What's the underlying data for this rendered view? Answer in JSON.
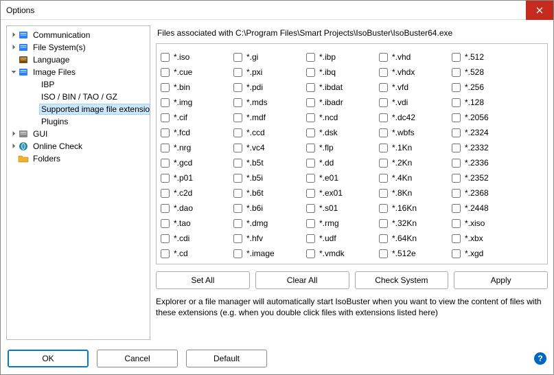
{
  "window": {
    "title": "Options"
  },
  "tree": [
    {
      "label": "Communication",
      "iconColor": "#2a7fff",
      "caret": ">",
      "indent": 1,
      "selected": false,
      "hasIcon": true
    },
    {
      "label": "File System(s)",
      "iconColor": "#2a7fff",
      "caret": ">",
      "indent": 1,
      "selected": false,
      "hasIcon": true
    },
    {
      "label": "Language",
      "iconColor": "#7f4f00",
      "caret": "",
      "indent": 1,
      "selected": false,
      "hasIcon": true
    },
    {
      "label": "Image Files",
      "iconColor": "#2a7fff",
      "caret": "v",
      "indent": 1,
      "selected": false,
      "hasIcon": true
    },
    {
      "label": "IBP",
      "iconColor": "",
      "caret": "",
      "indent": 2,
      "selected": false,
      "hasIcon": false
    },
    {
      "label": "ISO / BIN / TAO / GZ",
      "iconColor": "",
      "caret": "",
      "indent": 2,
      "selected": false,
      "hasIcon": false
    },
    {
      "label": "Supported image file extension",
      "iconColor": "",
      "caret": "",
      "indent": 2,
      "selected": true,
      "hasIcon": false
    },
    {
      "label": "Plugins",
      "iconColor": "",
      "caret": "",
      "indent": 2,
      "selected": false,
      "hasIcon": false
    },
    {
      "label": "GUI",
      "iconColor": "#888",
      "caret": ">",
      "indent": 1,
      "selected": false,
      "hasIcon": true
    },
    {
      "label": "Online Check",
      "iconColor": "#1a8f1a",
      "caret": ">",
      "indent": 1,
      "selected": false,
      "hasIcon": true
    },
    {
      "label": "Folders",
      "iconColor": "#f0b030",
      "caret": "",
      "indent": 1,
      "selected": false,
      "hasIcon": true
    }
  ],
  "heading": "Files associated with C:\\Program Files\\Smart Projects\\IsoBuster\\IsoBuster64.exe",
  "extensions": [
    [
      "*.iso",
      "*.cue",
      "*.bin",
      "*.img",
      "*.cif",
      "*.fcd",
      "*.nrg",
      "*.gcd",
      "*.p01",
      "*.c2d",
      "*.dao",
      "*.tao",
      "*.cdi",
      "*.cd"
    ],
    [
      "*.gi",
      "*.pxi",
      "*.pdi",
      "*.mds",
      "*.mdf",
      "*.ccd",
      "*.vc4",
      "*.b5t",
      "*.b5i",
      "*.b6t",
      "*.b6i",
      "*.dmg",
      "*.hfv",
      "*.image"
    ],
    [
      "*.ibp",
      "*.ibq",
      "*.ibdat",
      "*.ibadr",
      "*.ncd",
      "*.dsk",
      "*.flp",
      "*.dd",
      "*.e01",
      "*.ex01",
      "*.s01",
      "*.rmg",
      "*.udf",
      "*.vmdk"
    ],
    [
      "*.vhd",
      "*.vhdx",
      "*.vfd",
      "*.vdi",
      "*.dc42",
      "*.wbfs",
      "*.1Kn",
      "*.2Kn",
      "*.4Kn",
      "*.8Kn",
      "*.16Kn",
      "*.32Kn",
      "*.64Kn",
      "*.512e"
    ],
    [
      "*.512",
      "*.528",
      "*.256",
      "*.128",
      "*.2056",
      "*.2324",
      "*.2332",
      "*.2336",
      "*.2352",
      "*.2368",
      "*.2448",
      "*.xiso",
      "*.xbx",
      "*.xgd"
    ]
  ],
  "buttons": {
    "set_all": "Set All",
    "clear_all": "Clear All",
    "check_system": "Check System",
    "apply": "Apply"
  },
  "explain": "Explorer or a file manager will automatically start IsoBuster when you want to view the content of files with these extensions (e.g. when you double click files with extensions listed here)",
  "footer": {
    "ok": "OK",
    "cancel": "Cancel",
    "default": "Default"
  }
}
